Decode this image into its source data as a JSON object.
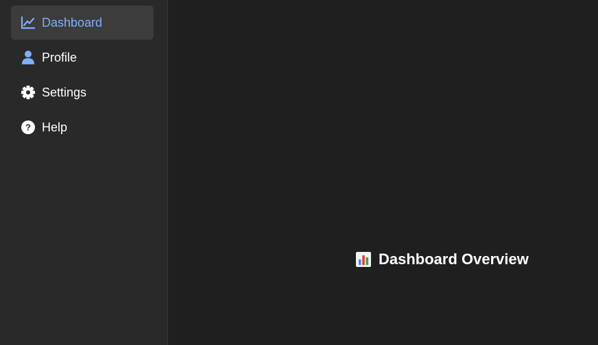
{
  "sidebar": {
    "items": [
      {
        "label": "Dashboard",
        "icon": "chart-line-icon",
        "active": true
      },
      {
        "label": "Profile",
        "icon": "user-icon",
        "active": false
      },
      {
        "label": "Settings",
        "icon": "gear-icon",
        "active": false
      },
      {
        "label": "Help",
        "icon": "help-circle-icon",
        "active": false
      }
    ]
  },
  "main": {
    "title": "Dashboard Overview",
    "title_icon": "bar-chart-emoji-icon"
  },
  "colors": {
    "accent": "#7fb0f5",
    "sidebar_bg": "#292929",
    "main_bg": "#1f1f1f",
    "active_bg": "#3c3c3c",
    "text": "#ffffff"
  }
}
